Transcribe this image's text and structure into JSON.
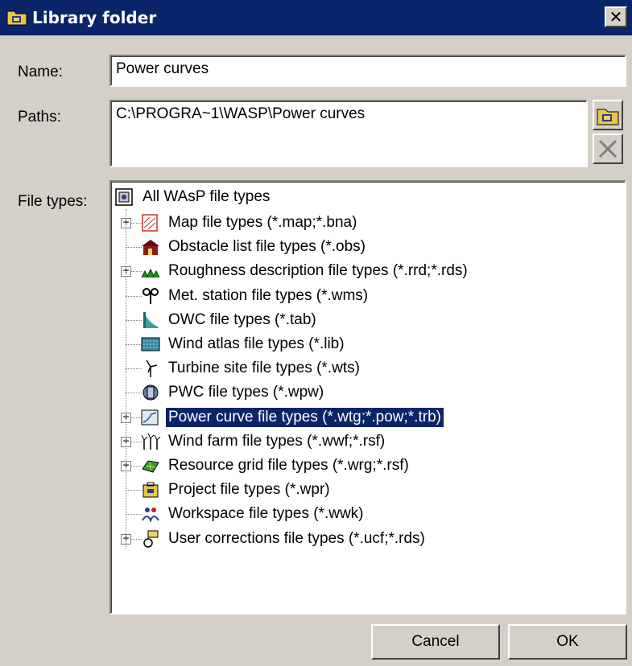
{
  "window": {
    "title": "Library folder",
    "close_label": "✕"
  },
  "form": {
    "name_label": "Name:",
    "name_value": "Power curves",
    "paths_label": "Paths:",
    "paths_value": "C:\\PROGRA~1\\WASP\\Power curves",
    "filetypes_label": "File types:"
  },
  "tree": {
    "root": "All WAsP file types",
    "items": [
      {
        "label": "Map file types (*.map;*.bna)",
        "expandable": true,
        "icon": "map-icon"
      },
      {
        "label": "Obstacle list file types (*.obs)",
        "expandable": false,
        "icon": "obstacle-icon"
      },
      {
        "label": "Roughness description file types (*.rrd;*.rds)",
        "expandable": true,
        "icon": "roughness-icon"
      },
      {
        "label": "Met. station file types (*.wms)",
        "expandable": false,
        "icon": "met-station-icon"
      },
      {
        "label": "OWC file types (*.tab)",
        "expandable": false,
        "icon": "owc-icon"
      },
      {
        "label": "Wind atlas file types (*.lib)",
        "expandable": false,
        "icon": "wind-atlas-icon"
      },
      {
        "label": "Turbine site file types (*.wts)",
        "expandable": false,
        "icon": "turbine-site-icon"
      },
      {
        "label": "PWC file types (*.wpw)",
        "expandable": false,
        "icon": "pwc-icon"
      },
      {
        "label": "Power curve file types (*.wtg;*.pow;*.trb)",
        "expandable": true,
        "icon": "power-curve-icon",
        "selected": true
      },
      {
        "label": "Wind farm file types (*.wwf;*.rsf)",
        "expandable": true,
        "icon": "wind-farm-icon"
      },
      {
        "label": "Resource grid file types (*.wrg;*.rsf)",
        "expandable": true,
        "icon": "resource-grid-icon"
      },
      {
        "label": "Project file types (*.wpr)",
        "expandable": false,
        "icon": "project-icon"
      },
      {
        "label": "Workspace file types (*.wwk)",
        "expandable": false,
        "icon": "workspace-icon"
      },
      {
        "label": "User corrections file types (*.ucf;*.rds)",
        "expandable": true,
        "icon": "user-corrections-icon"
      }
    ]
  },
  "buttons": {
    "cancel": "Cancel",
    "ok": "OK"
  },
  "colors": {
    "titlebar": "#0a246a",
    "face": "#d4d0c8",
    "selection": "#0a246a"
  }
}
